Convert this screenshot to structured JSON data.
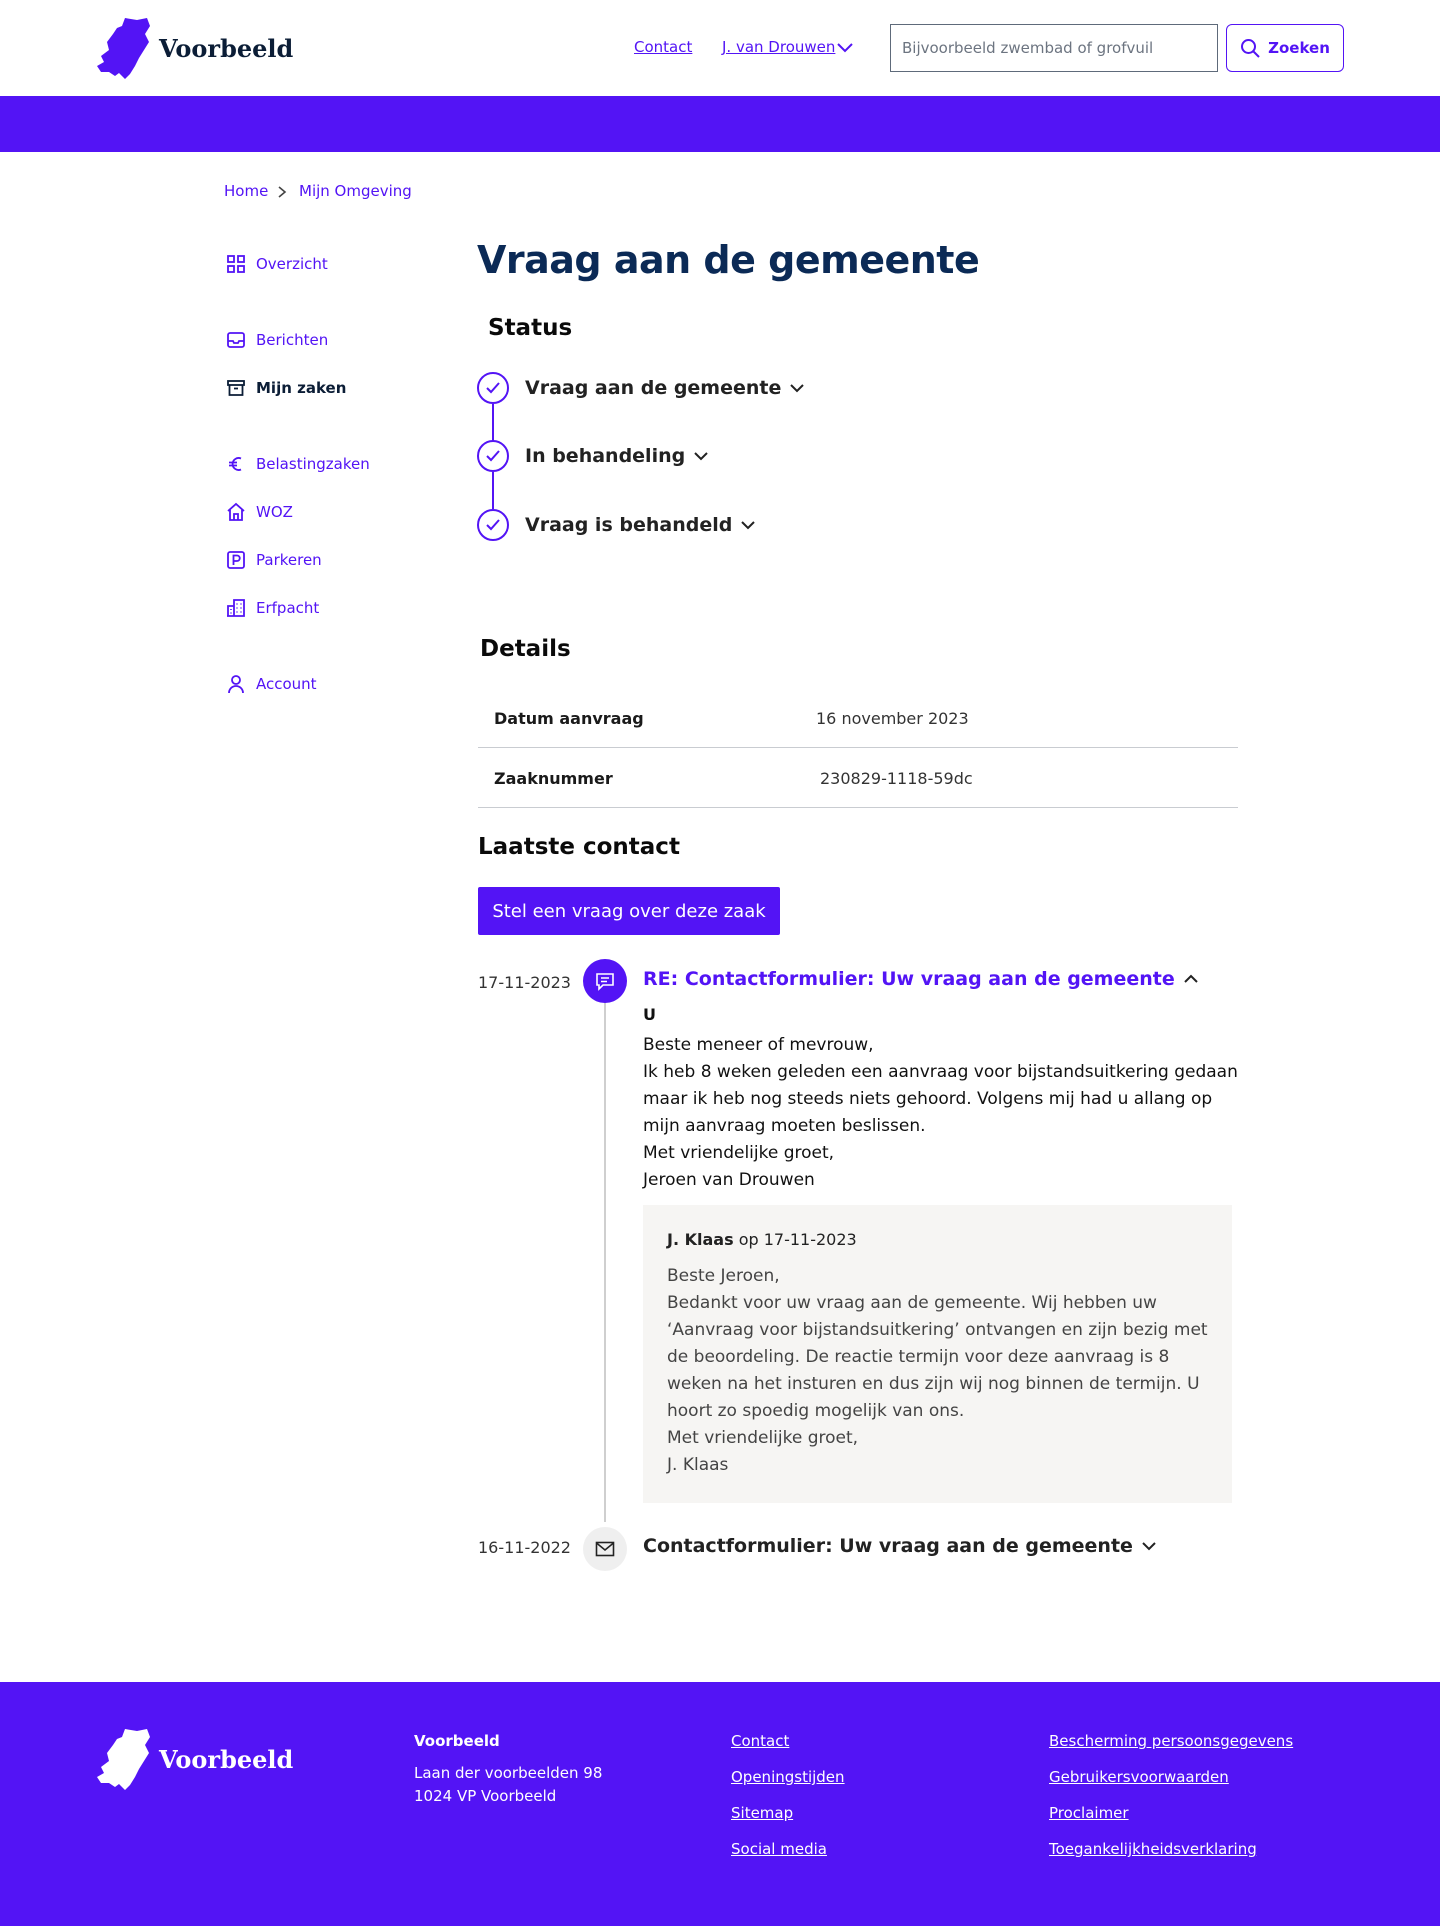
{
  "header": {
    "logo_text": "Voorbeeld",
    "contact_label": "Contact",
    "user_label": "J. van Drouwen",
    "search_placeholder": "Bijvoorbeeld zwembad of grofvuil",
    "search_button_label": "Zoeken"
  },
  "breadcrumb": {
    "items": [
      "Home",
      "Mijn Omgeving"
    ]
  },
  "sidebar": {
    "items": [
      {
        "label": "Overzicht",
        "icon": "grid-icon"
      },
      {
        "label": "Berichten",
        "icon": "inbox-icon"
      },
      {
        "label": "Mijn zaken",
        "icon": "archive-icon",
        "active": true
      },
      {
        "label": "Belastingzaken",
        "icon": "euro-icon"
      },
      {
        "label": "WOZ",
        "icon": "home-icon"
      },
      {
        "label": "Parkeren",
        "icon": "parking-icon"
      },
      {
        "label": "Erfpacht",
        "icon": "building-icon"
      },
      {
        "label": "Account",
        "icon": "user-icon"
      }
    ]
  },
  "main": {
    "title": "Vraag aan de gemeente",
    "status_heading": "Status",
    "status_steps": [
      {
        "label": "Vraag aan de gemeente",
        "done": true
      },
      {
        "label": "In behandeling",
        "done": true
      },
      {
        "label": "Vraag is behandeld",
        "done": true
      }
    ],
    "details_heading": "Details",
    "details": [
      {
        "key": "Datum aanvraag",
        "value": "16 november 2023"
      },
      {
        "key": "Zaaknummer",
        "value": "230829-1118-59dc"
      }
    ],
    "contact_heading": "Laatste contact",
    "ask_button_label": "Stel een vraag over deze zaak",
    "messages": [
      {
        "date": "17-11-2023",
        "title": "RE: Contactformulier: Uw vraag aan de gemeente",
        "icon": "chat-icon",
        "expanded": true,
        "sender": "U",
        "body": [
          "Beste meneer of mevrouw,",
          "Ik heb 8 weken geleden een aanvraag voor bijstandsuitkering gedaan maar ik heb nog steeds niets gehoord. Volgens mij had u allang op mijn aanvraag moeten beslissen.",
          "Met vriendelijke groet,",
          "Jeroen van Drouwen"
        ],
        "reply": {
          "author": "J. Klaas",
          "on_label": "op 17-11-2023",
          "body": [
            "Beste Jeroen,",
            "Bedankt voor uw vraag aan de gemeente. Wij hebben uw ‘Aanvraag voor bijstandsuitkering’ ontvangen en zijn bezig met de beoordeling. De reactie termijn voor deze aanvraag is 8 weken na het insturen en dus zijn wij nog binnen de termijn. U hoort zo spoedig mogelijk van ons.",
            "Met vriendelijke groet,",
            "J. Klaas"
          ]
        }
      },
      {
        "date": "16-11-2022",
        "title": "Contactformulier: Uw vraag aan de gemeente",
        "icon": "mail-icon",
        "expanded": false
      }
    ]
  },
  "footer": {
    "logo_text": "Voorbeeld",
    "org_name": "Voorbeeld",
    "address": [
      "Laan der voorbeelden 98",
      "1024 VP Voorbeeld"
    ],
    "links_col1": [
      "Contact",
      "Openingstijden",
      "Sitemap",
      "Social media"
    ],
    "links_col2": [
      "Bescherming persoonsgegevens",
      "Gebruikersvoorwaarden",
      "Proclaimer",
      "Toegankelijkheidsverklaring"
    ]
  },
  "colors": {
    "brand": "#5314f5",
    "title": "#0b2a56",
    "reply_bg": "#f6f5f3"
  }
}
